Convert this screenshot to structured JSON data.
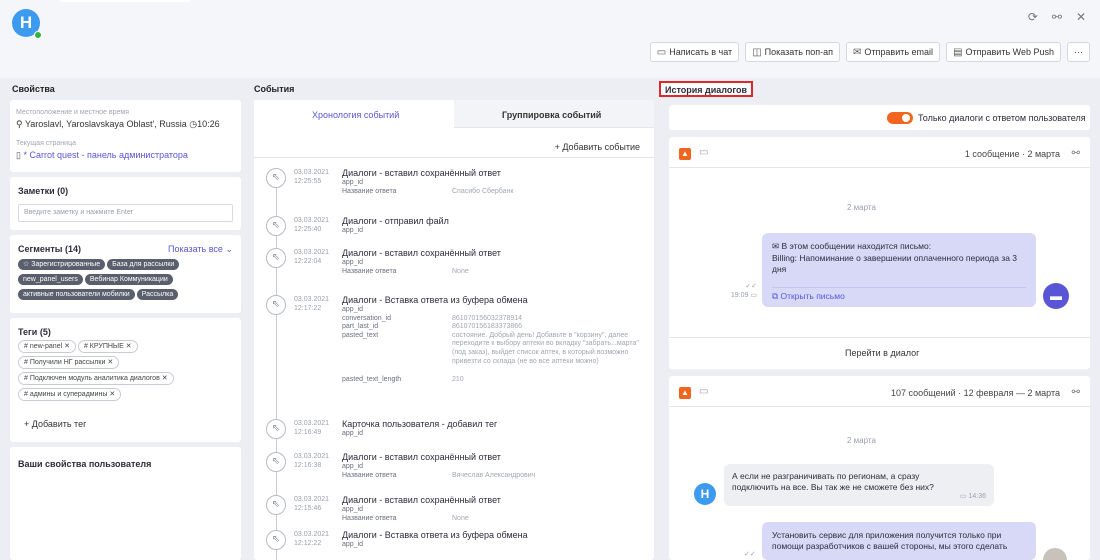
{
  "header": {
    "avatar_letter": "H",
    "icons": [
      "refresh-icon",
      "link-icon",
      "close-icon"
    ],
    "actions": [
      {
        "label": "Написать в чат",
        "icon": "chat-icon"
      },
      {
        "label": "Показать поп-ап",
        "icon": "popup-icon"
      },
      {
        "label": "Отправить email",
        "icon": "email-icon"
      },
      {
        "label": "Отправить Web Push",
        "icon": "push-icon"
      },
      {
        "label": "···",
        "icon": "more-icon"
      }
    ]
  },
  "properties": {
    "title": "Свойства",
    "location_label": "Местоположение и местное время",
    "location_value": "Yaroslavl, Yaroslavskaya Oblast', Russia",
    "local_time": "10:26",
    "page_label": "Текущая страница",
    "page_value": "* Carrot quest - панель администратора",
    "notes_title": "Заметки (0)",
    "notes_placeholder": "Введите заметку и нажмите Enter",
    "segments_title": "Сегменты (14)",
    "segments_show_all": "Показать все",
    "segments": [
      "Зарегистрированные",
      "База для рассылки",
      "new_panel_users",
      "Вебинар Коммуникации",
      "активные пользователи мобилки",
      "Рассылка"
    ],
    "tags_title": "Теги (5)",
    "tags": [
      "# new-panel",
      "# КРУПНЫЕ",
      "# Получили НГ рассылки",
      "# Подключен модуль аналитика диалогов",
      "# админы и суперадмины"
    ],
    "add_tag": "Добавить тег",
    "user_props_title": "Ваши свойства пользователя"
  },
  "events": {
    "title": "События",
    "tab_timeline": "Хронология событий",
    "tab_grouping": "Группировка событий",
    "add_event": "+ Добавить событие",
    "items": [
      {
        "date": "03.03.2021",
        "time": "12:25:55",
        "title": "Диалоги - вставил сохранённый ответ",
        "keys": [
          "app_id",
          "Название ответа"
        ],
        "vals": [
          "",
          "Спасибо Сбербанк"
        ]
      },
      {
        "date": "03.03.2021",
        "time": "12:25:40",
        "title": "Диалоги - отправил файл",
        "keys": [
          "app_id"
        ],
        "vals": [
          ""
        ]
      },
      {
        "date": "03.03.2021",
        "time": "12:22:04",
        "title": "Диалоги - вставил сохранённый ответ",
        "keys": [
          "app_id",
          "Название ответа"
        ],
        "vals": [
          "",
          "None"
        ]
      },
      {
        "date": "03.03.2021",
        "time": "12:17:22",
        "title": "Диалоги - Вставка ответа из буфера обмена",
        "keys": [
          "app_id",
          "conversation_id",
          "part_last_id",
          "pasted_text",
          "pasted_text_length"
        ],
        "vals": [
          "",
          "861070156032378914",
          "861070156183373866",
          "состояние. Добрый день! Добавьте в \"корзину\", далее переходите к выбору аптеки во вкладку \"забрать...марта\" (под заказ), выйдет список аптек, в который возможно привезти со склада (не во все аптеки можно)",
          "210"
        ]
      },
      {
        "date": "03.03.2021",
        "time": "12:16:49",
        "title": "Карточка пользователя - добавил тег",
        "keys": [
          "app_id"
        ],
        "vals": [
          ""
        ]
      },
      {
        "date": "03.03.2021",
        "time": "12:16:38",
        "title": "Диалоги - вставил сохранённый ответ",
        "keys": [
          "app_id",
          "Название ответа"
        ],
        "vals": [
          "",
          "Вячеслав Александрович"
        ]
      },
      {
        "date": "03.03.2021",
        "time": "12:15:46",
        "title": "Диалоги - вставил сохранённый ответ",
        "keys": [
          "app_id",
          "Название ответа"
        ],
        "vals": [
          "",
          "None"
        ]
      },
      {
        "date": "03.03.2021",
        "time": "12:12:22",
        "title": "Диалоги - Вставка ответа из буфера обмена",
        "keys": [
          "app_id"
        ],
        "vals": [
          ""
        ]
      }
    ]
  },
  "dialogs": {
    "title": "История диалогов",
    "toggle_label": "Только диалоги с ответом пользователя",
    "accent": "#f1651f",
    "card1": {
      "summary": "1 сообщение · 2 марта",
      "date": "2 марта",
      "email_line": "В этом сообщении находится письмо:",
      "email_text": "Billing: Напоминание о завершении оплаченного периода за 3 дня",
      "open_letter": "Открыть письмо",
      "time": "19:09",
      "go_to": "Перейти в диалог"
    },
    "card2": {
      "summary": "107 сообщений · 12 февраля — 2 марта",
      "date": "2 марта",
      "in_text": "А если не разграничивать по регионам, а сразу подключить на все. Вы так же не сможете без них?",
      "in_time": "14:36",
      "out_text": "Установить сервис для приложения получится только при помощи разработчиков с вашей стороны, мы этого сделать"
    }
  }
}
